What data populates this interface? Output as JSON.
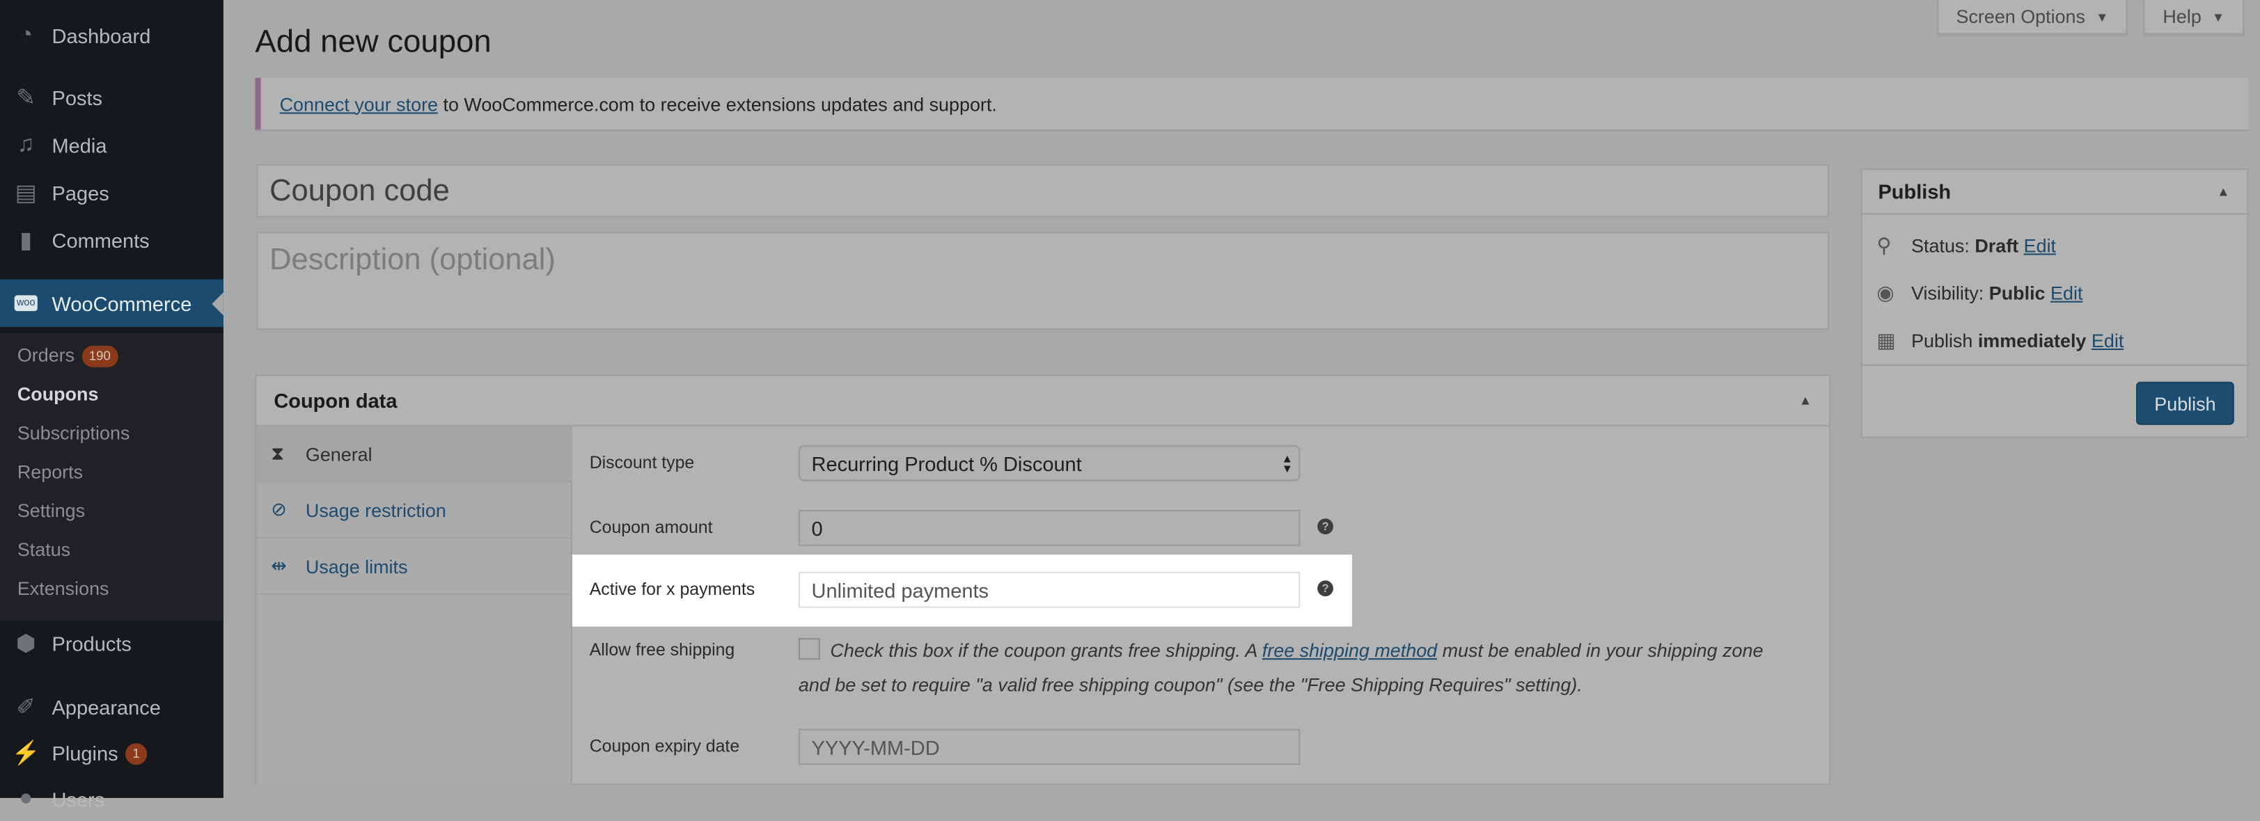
{
  "sidebar": {
    "items": [
      {
        "label": "Dashboard",
        "icon": "dashboard-icon"
      },
      {
        "label": "Posts",
        "icon": "pin-icon"
      },
      {
        "label": "Media",
        "icon": "media-icon"
      },
      {
        "label": "Pages",
        "icon": "pages-icon"
      },
      {
        "label": "Comments",
        "icon": "comment-icon"
      },
      {
        "label": "WooCommerce",
        "icon": "woo-icon"
      },
      {
        "label": "Products",
        "icon": "box-icon"
      },
      {
        "label": "Appearance",
        "icon": "brush-icon"
      },
      {
        "label": "Plugins",
        "icon": "plug-icon",
        "badge": "1"
      },
      {
        "label": "Users",
        "icon": "user-icon"
      }
    ],
    "woo_icon_text": "woo",
    "submenu": [
      {
        "label": "Orders",
        "badge": "190"
      },
      {
        "label": "Coupons"
      },
      {
        "label": "Subscriptions"
      },
      {
        "label": "Reports"
      },
      {
        "label": "Settings"
      },
      {
        "label": "Status"
      },
      {
        "label": "Extensions"
      }
    ]
  },
  "header": {
    "screen_options": "Screen Options",
    "help": "Help",
    "title": "Add new coupon"
  },
  "notice": {
    "link": "Connect your store",
    "text": " to WooCommerce.com to receive extensions updates and support."
  },
  "coupon_code": {
    "placeholder": "Coupon code"
  },
  "description": {
    "placeholder": "Description (optional)"
  },
  "coupon_data": {
    "title": "Coupon data",
    "tabs": [
      {
        "label": "General"
      },
      {
        "label": "Usage restriction"
      },
      {
        "label": "Usage limits"
      }
    ],
    "discount_type": {
      "label": "Discount type",
      "value": "Recurring Product % Discount"
    },
    "coupon_amount": {
      "label": "Coupon amount",
      "value": "0"
    },
    "active_payments": {
      "label": "Active for x payments",
      "placeholder": "Unlimited payments"
    },
    "free_shipping": {
      "label": "Allow free shipping",
      "checked": false,
      "text1": "Check this box if the coupon grants free shipping. A ",
      "link": "free shipping method",
      "text2": " must be enabled in your shipping zone",
      "text3": "and be set to require \"a valid free shipping coupon\" (see the \"Free Shipping Requires\" setting)."
    },
    "expiry": {
      "label": "Coupon expiry date",
      "placeholder": "YYYY-MM-DD"
    }
  },
  "publish": {
    "title": "Publish",
    "status_label": "Status: ",
    "status_value": "Draft",
    "visibility_label": "Visibility: ",
    "visibility_value": "Public",
    "schedule_label": "Publish ",
    "schedule_value": "immediately",
    "edit": "Edit",
    "button": "Publish"
  },
  "colors": {
    "accent": "#1d4e72",
    "sidebar": "#15191c",
    "highlight": "#ffffff"
  }
}
